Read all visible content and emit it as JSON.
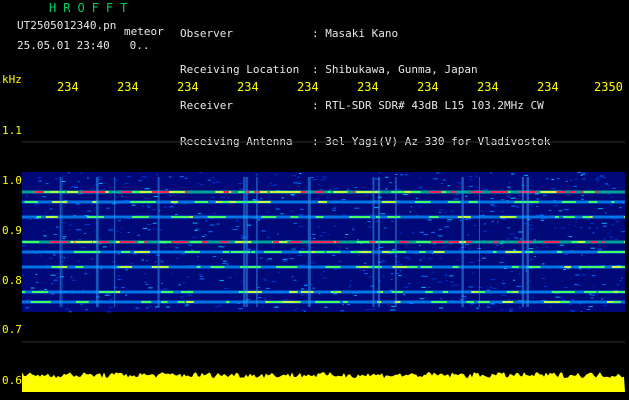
{
  "app": {
    "logo_text": "HROFFT",
    "file_name": "UT2505012340.pn",
    "tag": "meteor",
    "datetime": "25.05.01 23:40",
    "datetime_suffix": "0.."
  },
  "info": [
    {
      "label": "Observer",
      "value": ": Masaki Kano"
    },
    {
      "label": "Receiving Location",
      "value": ": Shibukawa, Gunma, Japan"
    },
    {
      "label": "Receiver",
      "value": ": RTL-SDR SDR# 43dB L15 103.2MHz CW"
    },
    {
      "label": "Receiving Antenna",
      "value": ": 3el Yagi(V) Az 330 for Vladivostok"
    }
  ],
  "y_unit": "kHz",
  "colors": {
    "label": "#ffff00",
    "header_text": "#e8e8e8",
    "logo": "#00d060",
    "background": "#000000",
    "spectrum_low": "#000a8c",
    "spectrum_mid": "#00b4ff",
    "spectrum_high": "#ff2060",
    "level_bar": "#ffff00"
  },
  "chart_data": {
    "type": "heatmap",
    "title": "",
    "xlabel": "",
    "ylabel": "kHz",
    "x_ticks": [
      "234",
      "234",
      "234",
      "234",
      "234",
      "234",
      "234",
      "234",
      "234",
      "2350"
    ],
    "y_ticks": [
      "1.1",
      "1.0",
      "0.9",
      "0.8",
      "0.7",
      "0.6"
    ],
    "ylim": [
      0.6,
      1.2
    ],
    "signal_band_khz": [
      0.76,
      1.04
    ],
    "bright_lines_khz": [
      1.0,
      0.98,
      0.95,
      0.9,
      0.88,
      0.85,
      0.8,
      0.78
    ],
    "strongest_lines_khz": [
      1.0,
      0.9
    ]
  }
}
